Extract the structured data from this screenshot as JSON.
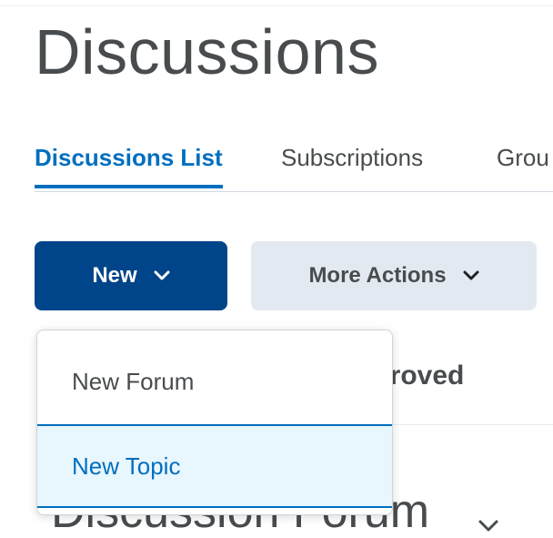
{
  "page": {
    "title": "Discussions"
  },
  "tabs": [
    {
      "label": "Discussions List",
      "active": true
    },
    {
      "label": "Subscriptions",
      "active": false
    },
    {
      "label": "Grou",
      "active": false
    }
  ],
  "toolbar": {
    "new_label": "New",
    "more_actions_label": "More Actions"
  },
  "dropdown": {
    "items": [
      {
        "label": "New Forum",
        "highlighted": false
      },
      {
        "label": "New Topic",
        "highlighted": true
      }
    ]
  },
  "background": {
    "column_header_partial": "pproved",
    "forum_heading_partial": "Discussion Forum"
  },
  "colors": {
    "primary": "#004489",
    "link": "#006fbf",
    "secondary_button": "#e3e9f1",
    "highlight_bg": "#e8f6fd"
  },
  "icons": {
    "new_chevron": "chevron-down-icon",
    "more_chevron": "chevron-down-icon",
    "forum_chevron": "chevron-down-icon"
  }
}
